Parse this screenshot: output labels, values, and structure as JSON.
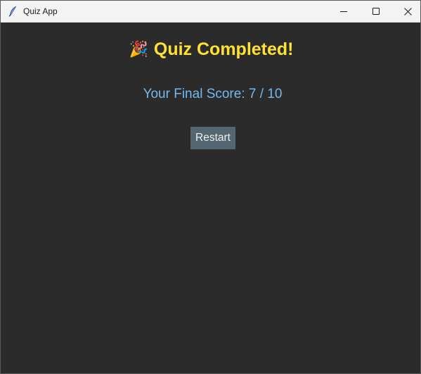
{
  "window": {
    "title": "Quiz App",
    "icon": "feather-icon",
    "controls": [
      "minimize-icon",
      "maximize-icon",
      "close-icon"
    ]
  },
  "quiz": {
    "heading_emoji": "🎉",
    "heading": "Quiz Completed!",
    "score_text": "Your Final Score: 7 / 10",
    "restart_label": "Restart"
  },
  "colors": {
    "background": "#2b2b2b",
    "heading": "#ffe135",
    "score": "#74b9ee",
    "button_bg": "#546670",
    "button_text": "#eef1f2"
  }
}
